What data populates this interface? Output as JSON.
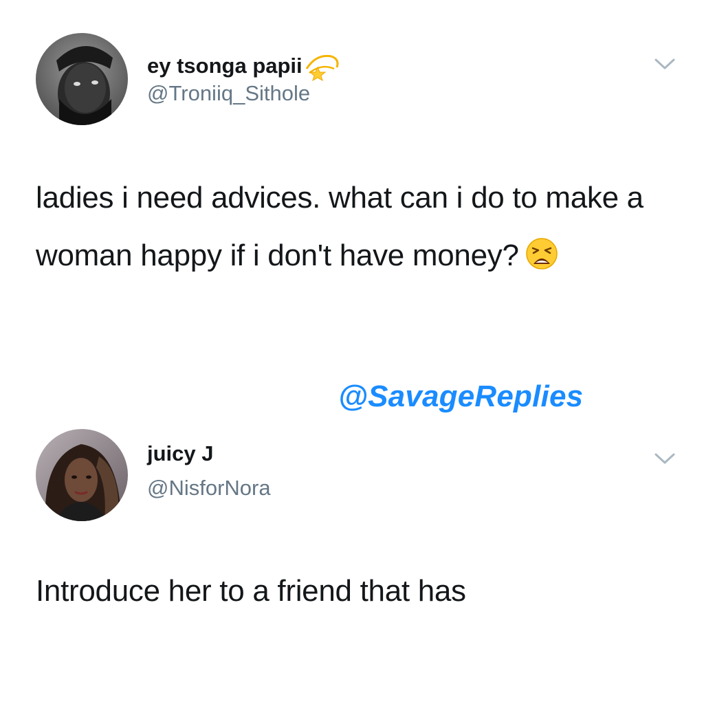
{
  "tweets": [
    {
      "display_name": "ey tsonga papii",
      "handle": "@Troniiq_Sithole",
      "name_emoji": "dizzy-emoji",
      "text": "ladies i need advices. what can i do to make a woman happy if i don't have money?",
      "text_emoji": "weary-face-emoji"
    },
    {
      "display_name": "juicy J",
      "handle": "@NisforNora",
      "text": "Introduce her to a friend that has"
    }
  ],
  "watermark": "@SavageReplies",
  "icons": {
    "chevron": "chevron-down-icon"
  },
  "colors": {
    "name": "#14171a",
    "handle": "#657786",
    "watermark": "#1a8cff",
    "chevron": "#aab8c2"
  }
}
